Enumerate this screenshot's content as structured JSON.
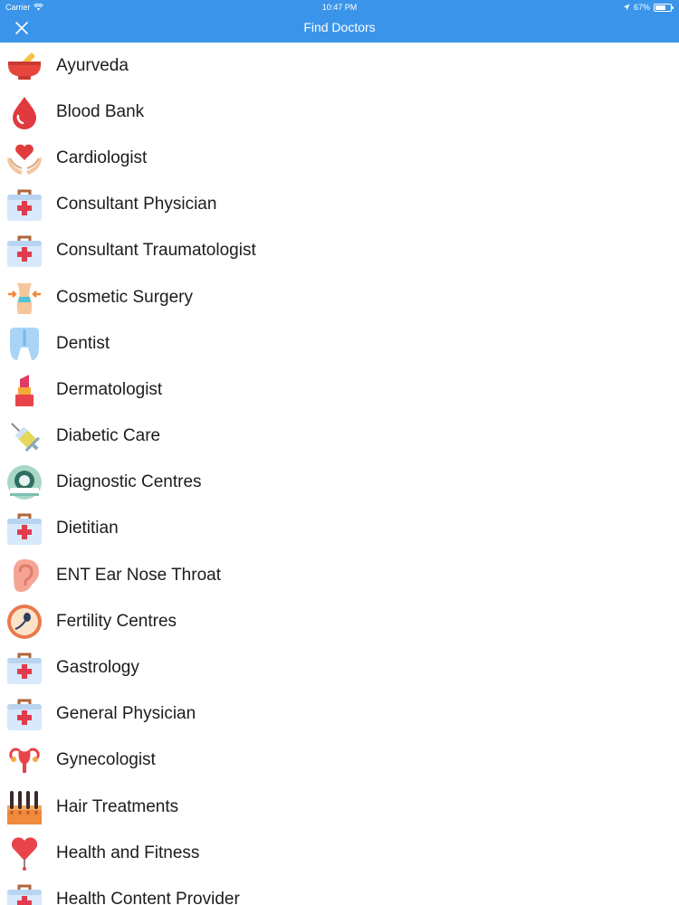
{
  "status_bar": {
    "carrier": "Carrier",
    "time": "10:47 PM",
    "battery": "67%",
    "battery_level": 0.67
  },
  "nav": {
    "title": "Find Doctors",
    "close_icon": "close-icon"
  },
  "colors": {
    "header": "#3a95ea",
    "text": "#1c1c1c"
  },
  "specialties": [
    {
      "label": "Ayurveda",
      "icon": "mortar-pestle-icon"
    },
    {
      "label": "Blood Bank",
      "icon": "blood-drop-icon"
    },
    {
      "label": "Cardiologist",
      "icon": "heart-hands-icon"
    },
    {
      "label": "Consultant Physician",
      "icon": "medical-kit-icon"
    },
    {
      "label": "Consultant Traumatologist",
      "icon": "medical-kit-icon"
    },
    {
      "label": "Cosmetic Surgery",
      "icon": "body-contour-icon"
    },
    {
      "label": "Dentist",
      "icon": "tooth-icon"
    },
    {
      "label": "Dermatologist",
      "icon": "lipstick-icon"
    },
    {
      "label": "Diabetic Care",
      "icon": "syringe-icon"
    },
    {
      "label": "Diagnostic Centres",
      "icon": "mri-scanner-icon"
    },
    {
      "label": "Dietitian",
      "icon": "medical-kit-icon"
    },
    {
      "label": "ENT Ear Nose Throat",
      "icon": "ear-icon"
    },
    {
      "label": "Fertility Centres",
      "icon": "sperm-egg-icon"
    },
    {
      "label": "Gastrology",
      "icon": "medical-kit-icon"
    },
    {
      "label": "General Physician",
      "icon": "medical-kit-icon"
    },
    {
      "label": "Gynecologist",
      "icon": "uterus-icon"
    },
    {
      "label": "Hair Treatments",
      "icon": "hair-follicles-icon"
    },
    {
      "label": "Health and Fitness",
      "icon": "heart-pin-icon"
    },
    {
      "label": "Health Content Provider",
      "icon": "medical-kit-icon"
    }
  ]
}
